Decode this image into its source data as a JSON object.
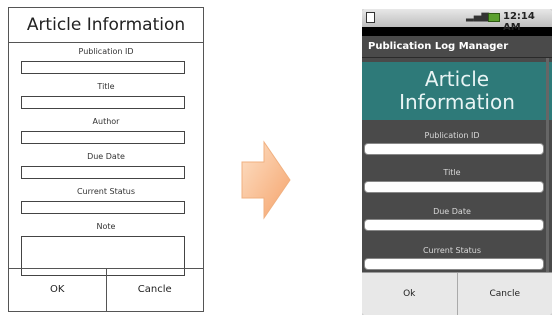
{
  "wireframe": {
    "title": "Article Information",
    "fields": [
      "Publication ID",
      "Title",
      "Author",
      "Due Date",
      "Current Status",
      "Note"
    ],
    "ok_label": "OK",
    "cancel_label": "Cancle"
  },
  "phone": {
    "status_time": "12:14 AM",
    "app_title": "Publication Log Manager",
    "header_line1": "Article",
    "header_line2": "Information",
    "fields": [
      "Publication ID",
      "Title",
      "Due Date",
      "Current Status"
    ],
    "ok_label": "Ok",
    "cancel_label": "Cancle"
  }
}
